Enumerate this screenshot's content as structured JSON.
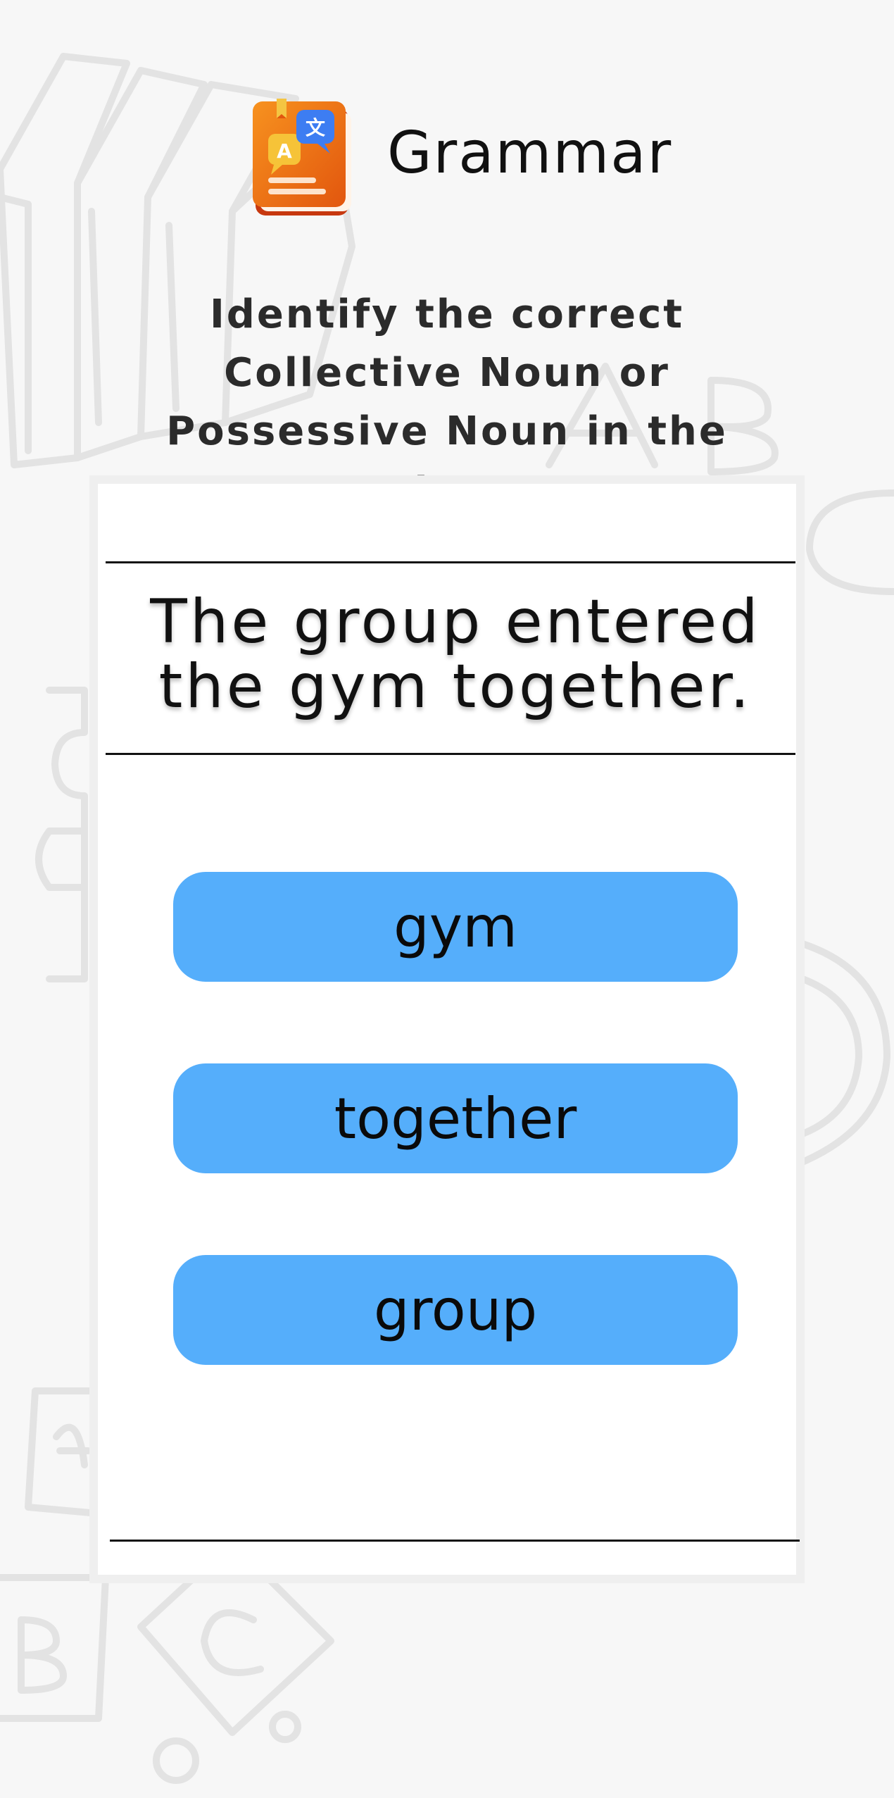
{
  "header": {
    "icon": "grammar-book-icon",
    "title": "Grammar"
  },
  "instruction": "Identify the correct Collective Noun or Possessive Noun in the sentence.",
  "question": {
    "sentence": "The group entered the gym together."
  },
  "options": [
    {
      "label": "gym"
    },
    {
      "label": "together"
    },
    {
      "label": "group"
    }
  ],
  "colors": {
    "background": "#f7f7f7",
    "option_button": "#55aefb",
    "icon_book": "#f07a1a"
  }
}
